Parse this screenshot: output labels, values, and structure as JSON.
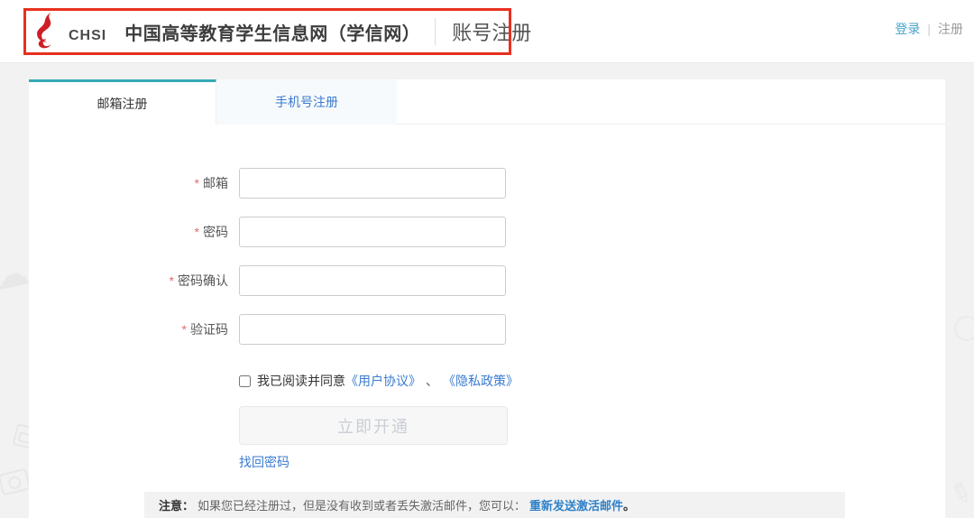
{
  "header": {
    "logo_text": "CHSI",
    "site_title": "中国高等教育学生信息网（学信网）",
    "page_title": "账号注册",
    "login_label": "登录",
    "divider": "|",
    "register_label": "注册"
  },
  "tabs": [
    {
      "label": "邮箱注册",
      "active": true
    },
    {
      "label": "手机号注册",
      "active": false
    }
  ],
  "form": {
    "required_marker": "*",
    "fields": [
      {
        "label": "邮箱"
      },
      {
        "label": "密码"
      },
      {
        "label": "密码确认"
      },
      {
        "label": "验证码"
      }
    ],
    "agreement": {
      "prefix": "我已阅读并同意",
      "user_agreement": "《用户协议》",
      "separator": "、",
      "privacy_policy": "《隐私政策》"
    },
    "submit_label": "立即开通",
    "forgot_password": "找回密码"
  },
  "notice": {
    "prefix": "注意：",
    "text": "如果您已经注册过，但是没有收到或者丢失激活邮件，您可以：",
    "link": "重新发送激活邮件",
    "suffix": "。"
  },
  "colors": {
    "accent_teal": "#36a9b4",
    "link_blue": "#3a7bd0",
    "annotation_red": "#e8301f",
    "logo_red": "#ce1e26"
  }
}
